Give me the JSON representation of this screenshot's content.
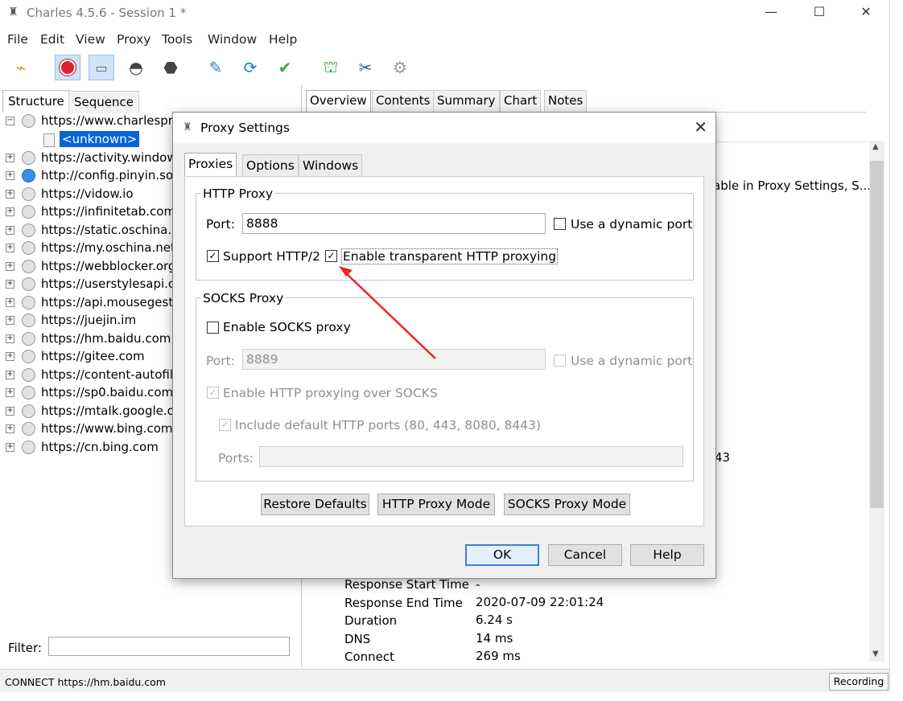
{
  "window": {
    "title": "Charles 4.5.6 - Session 1 *"
  },
  "menu": [
    "File",
    "Edit",
    "View",
    "Proxy",
    "Tools",
    "Window",
    "Help"
  ],
  "toolbar": [
    "broom-icon",
    "record-icon",
    "throttle-icon",
    "turtle-icon",
    "stop-icon",
    "pen-icon",
    "refresh-icon",
    "check-icon",
    "basket-icon",
    "tools-icon",
    "gear-icon"
  ],
  "left": {
    "tabs": [
      "Structure",
      "Sequence"
    ],
    "tree": [
      {
        "label": "https://www.charlespro",
        "expanded": true
      },
      {
        "label": "<unknown>",
        "child": true
      },
      {
        "label": "https://activity.window"
      },
      {
        "label": "http://config.pinyin.so",
        "globe": true
      },
      {
        "label": "https://vidow.io"
      },
      {
        "label": "https://infinitetab.com"
      },
      {
        "label": "https://static.oschina.n"
      },
      {
        "label": "https://my.oschina.net"
      },
      {
        "label": "https://webblocker.org"
      },
      {
        "label": "https://userstylesapi.co"
      },
      {
        "label": "https://api.mousegestu"
      },
      {
        "label": "https://juejin.im"
      },
      {
        "label": "https://hm.baidu.com"
      },
      {
        "label": "https://gitee.com"
      },
      {
        "label": "https://content-autofil"
      },
      {
        "label": "https://sp0.baidu.com"
      },
      {
        "label": "https://mtalk.google.c"
      },
      {
        "label": "https://www.bing.com"
      },
      {
        "label": "https://cn.bing.com"
      }
    ],
    "filter_label": "Filter:"
  },
  "right": {
    "tabs": [
      "Overview",
      "Contents",
      "Summary",
      "Chart",
      "Notes"
    ],
    "note_text": "able in Proxy Settings, S...",
    "partial_43": "43",
    "rows": [
      {
        "key": "Response Start Time",
        "value": "-"
      },
      {
        "key": "Response End Time",
        "value": "2020-07-09 22:01:24"
      },
      {
        "key": "Duration",
        "value": "6.24 s"
      },
      {
        "key": "DNS",
        "value": "14 ms"
      },
      {
        "key": "Connect",
        "value": "269 ms"
      }
    ]
  },
  "status": {
    "text": "CONNECT https://hm.baidu.com",
    "recording": "Recording"
  },
  "dialog": {
    "title": "Proxy Settings",
    "tabs": [
      "Proxies",
      "Options",
      "Windows"
    ],
    "http_proxy": {
      "group": "HTTP Proxy",
      "port_label": "Port:",
      "port_value": "8888",
      "dynamic_port": "Use a dynamic port",
      "support_http2": "Support HTTP/2",
      "transparent": "Enable transparent HTTP proxying"
    },
    "socks_proxy": {
      "group": "SOCKS Proxy",
      "enable": "Enable SOCKS proxy",
      "port_label": "Port:",
      "port_value": "8889",
      "dynamic_port": "Use a dynamic port",
      "http_over_socks": "Enable HTTP proxying over SOCKS",
      "include_default": "Include default HTTP ports (80, 443, 8080, 8443)",
      "ports_label": "Ports:"
    },
    "buttons": {
      "restore": "Restore Defaults",
      "http_mode": "HTTP Proxy Mode",
      "socks_mode": "SOCKS Proxy Mode",
      "ok": "OK",
      "cancel": "Cancel",
      "help": "Help"
    },
    "annotation_arrow_color": "#e8262b"
  }
}
